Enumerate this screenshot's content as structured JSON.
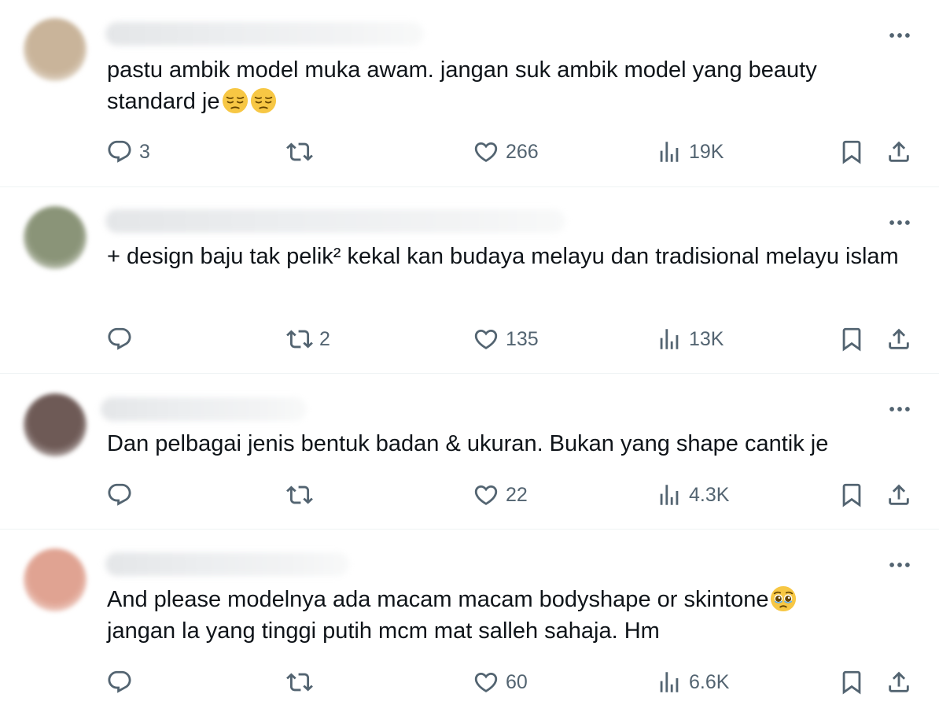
{
  "tweets": [
    {
      "text": "pastu ambik model muka awam. jangan suk ambik model yang beauty standard je",
      "emojis": [
        "pensive-face-emoji",
        "pensive-face-emoji"
      ],
      "reply_count": "3",
      "retweet_count": "",
      "like_count": "266",
      "view_count": "19K",
      "avatar_color": "#c9b49a"
    },
    {
      "text": "+ design baju tak pelik² kekal kan budaya melayu dan tradisional melayu islam",
      "emojis": [],
      "reply_count": "",
      "retweet_count": "2",
      "like_count": "135",
      "view_count": "13K",
      "avatar_color": "#8a9478"
    },
    {
      "text": "Dan pelbagai jenis bentuk badan & ukuran. Bukan yang shape cantik je",
      "emojis": [],
      "reply_count": "",
      "retweet_count": "",
      "like_count": "22",
      "view_count": "4.3K",
      "avatar_color": "#6e5a56"
    },
    {
      "text": "And please modelnya ada macam macam bodyshape or skintone",
      "text_line2": "jangan la yang tinggi putih mcm mat salleh sahaja. Hm",
      "emojis": [
        "pleading-face-emoji"
      ],
      "reply_count": "",
      "retweet_count": "",
      "like_count": "60",
      "view_count": "6.6K",
      "avatar_color": "#e0a392"
    }
  ],
  "icons": {
    "reply": "reply-icon",
    "retweet": "retweet-icon",
    "like": "heart-icon",
    "views": "views-icon",
    "bookmark": "bookmark-icon",
    "share": "share-icon",
    "more": "more-icon"
  },
  "colors": {
    "text": "#0f1419",
    "secondary": "#536471",
    "divider": "#eff3f4",
    "emoji_yellow": "#f7c744"
  }
}
